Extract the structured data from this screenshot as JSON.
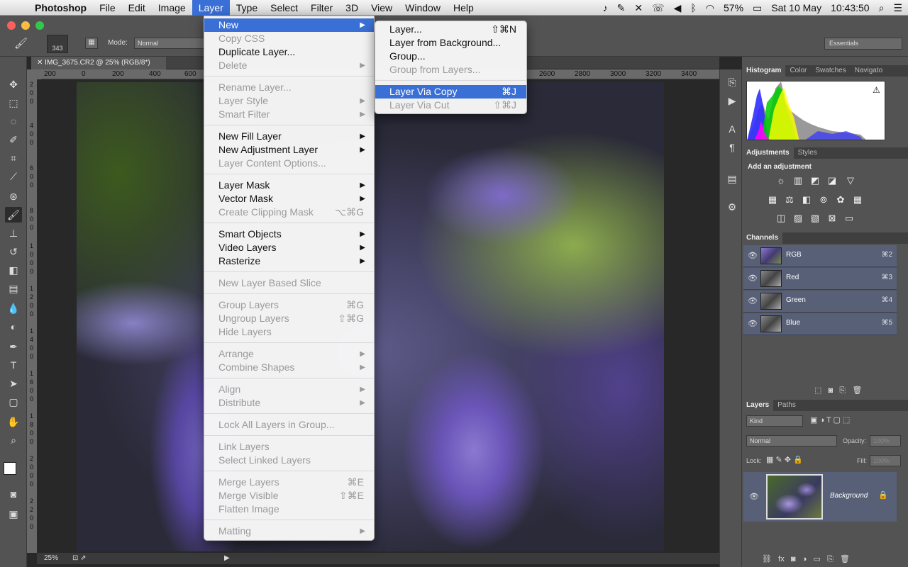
{
  "menubar": {
    "app": "Photoshop",
    "items": [
      "File",
      "Edit",
      "Image",
      "Layer",
      "Type",
      "Select",
      "Filter",
      "3D",
      "View",
      "Window",
      "Help"
    ],
    "active": "Layer",
    "status": {
      "battery": "57%",
      "date": "Sat 10 May",
      "time": "10:43:50"
    }
  },
  "options": {
    "brush_size": "343",
    "mode_label": "Mode:",
    "mode_value": "Normal",
    "workspace": "Essentials"
  },
  "document": {
    "tab": "IMG_3675.CR2 @ 25% (RGB/8*)",
    "zoom": "25%",
    "hruler": [
      "200",
      "0",
      "200",
      "400",
      "600",
      "2600",
      "2800",
      "3000",
      "3200",
      "3400"
    ],
    "vruler": [
      "2",
      "0",
      "0",
      "4",
      "0",
      "0",
      "6",
      "0",
      "0",
      "8",
      "0",
      "0",
      "1",
      "0",
      "0",
      "0",
      "1",
      "2",
      "0",
      "0",
      "1",
      "4",
      "0",
      "0",
      "1",
      "6",
      "0",
      "0",
      "1",
      "8",
      "0",
      "0",
      "2",
      "0",
      "0",
      "0",
      "2",
      "2",
      "0",
      "0"
    ]
  },
  "layer_menu": {
    "items": [
      {
        "label": "New",
        "sub": true,
        "hl": true
      },
      {
        "label": "Copy CSS",
        "dis": true
      },
      {
        "label": "Duplicate Layer..."
      },
      {
        "label": "Delete",
        "sub": true,
        "dis": true
      },
      {
        "sep": true
      },
      {
        "label": "Rename Layer...",
        "dis": true
      },
      {
        "label": "Layer Style",
        "sub": true,
        "dis": true
      },
      {
        "label": "Smart Filter",
        "sub": true,
        "dis": true
      },
      {
        "sep": true
      },
      {
        "label": "New Fill Layer",
        "sub": true
      },
      {
        "label": "New Adjustment Layer",
        "sub": true
      },
      {
        "label": "Layer Content Options...",
        "dis": true
      },
      {
        "sep": true
      },
      {
        "label": "Layer Mask",
        "sub": true
      },
      {
        "label": "Vector Mask",
        "sub": true
      },
      {
        "label": "Create Clipping Mask",
        "dis": true,
        "sc": "⌥⌘G"
      },
      {
        "sep": true
      },
      {
        "label": "Smart Objects",
        "sub": true
      },
      {
        "label": "Video Layers",
        "sub": true
      },
      {
        "label": "Rasterize",
        "sub": true
      },
      {
        "sep": true
      },
      {
        "label": "New Layer Based Slice",
        "dis": true
      },
      {
        "sep": true
      },
      {
        "label": "Group Layers",
        "dis": true,
        "sc": "⌘G"
      },
      {
        "label": "Ungroup Layers",
        "dis": true,
        "sc": "⇧⌘G"
      },
      {
        "label": "Hide Layers",
        "dis": true
      },
      {
        "sep": true
      },
      {
        "label": "Arrange",
        "sub": true,
        "dis": true
      },
      {
        "label": "Combine Shapes",
        "sub": true,
        "dis": true
      },
      {
        "sep": true
      },
      {
        "label": "Align",
        "sub": true,
        "dis": true
      },
      {
        "label": "Distribute",
        "sub": true,
        "dis": true
      },
      {
        "sep": true
      },
      {
        "label": "Lock All Layers in Group...",
        "dis": true
      },
      {
        "sep": true
      },
      {
        "label": "Link Layers",
        "dis": true
      },
      {
        "label": "Select Linked Layers",
        "dis": true
      },
      {
        "sep": true
      },
      {
        "label": "Merge Layers",
        "dis": true,
        "sc": "⌘E"
      },
      {
        "label": "Merge Visible",
        "dis": true,
        "sc": "⇧⌘E"
      },
      {
        "label": "Flatten Image",
        "dis": true
      },
      {
        "sep": true
      },
      {
        "label": "Matting",
        "sub": true,
        "dis": true
      }
    ]
  },
  "new_submenu": {
    "items": [
      {
        "label": "Layer...",
        "sc": "⇧⌘N"
      },
      {
        "label": "Layer from Background..."
      },
      {
        "label": "Group..."
      },
      {
        "label": "Group from Layers...",
        "dis": true
      },
      {
        "sep": true
      },
      {
        "label": "Layer Via Copy",
        "sc": "⌘J",
        "hl": true
      },
      {
        "label": "Layer Via Cut",
        "sc": "⇧⌘J",
        "dis": true
      }
    ]
  },
  "panels": {
    "histogram_tabs": [
      "Histogram",
      "Color",
      "Swatches",
      "Navigato"
    ],
    "adjust_tabs": [
      "Adjustments",
      "Styles"
    ],
    "adjust_title": "Add an adjustment",
    "channels_tab": "Channels",
    "channels": [
      {
        "name": "RGB",
        "sc": "⌘2"
      },
      {
        "name": "Red",
        "sc": "⌘3"
      },
      {
        "name": "Green",
        "sc": "⌘4"
      },
      {
        "name": "Blue",
        "sc": "⌘5"
      }
    ],
    "layers_tabs": [
      "Layers",
      "Paths"
    ],
    "kind": "Kind",
    "blend": "Normal",
    "opacity_label": "Opacity:",
    "opacity": "100%",
    "lock_label": "Lock:",
    "fill_label": "Fill:",
    "fill": "100%",
    "layer_name": "Background"
  }
}
